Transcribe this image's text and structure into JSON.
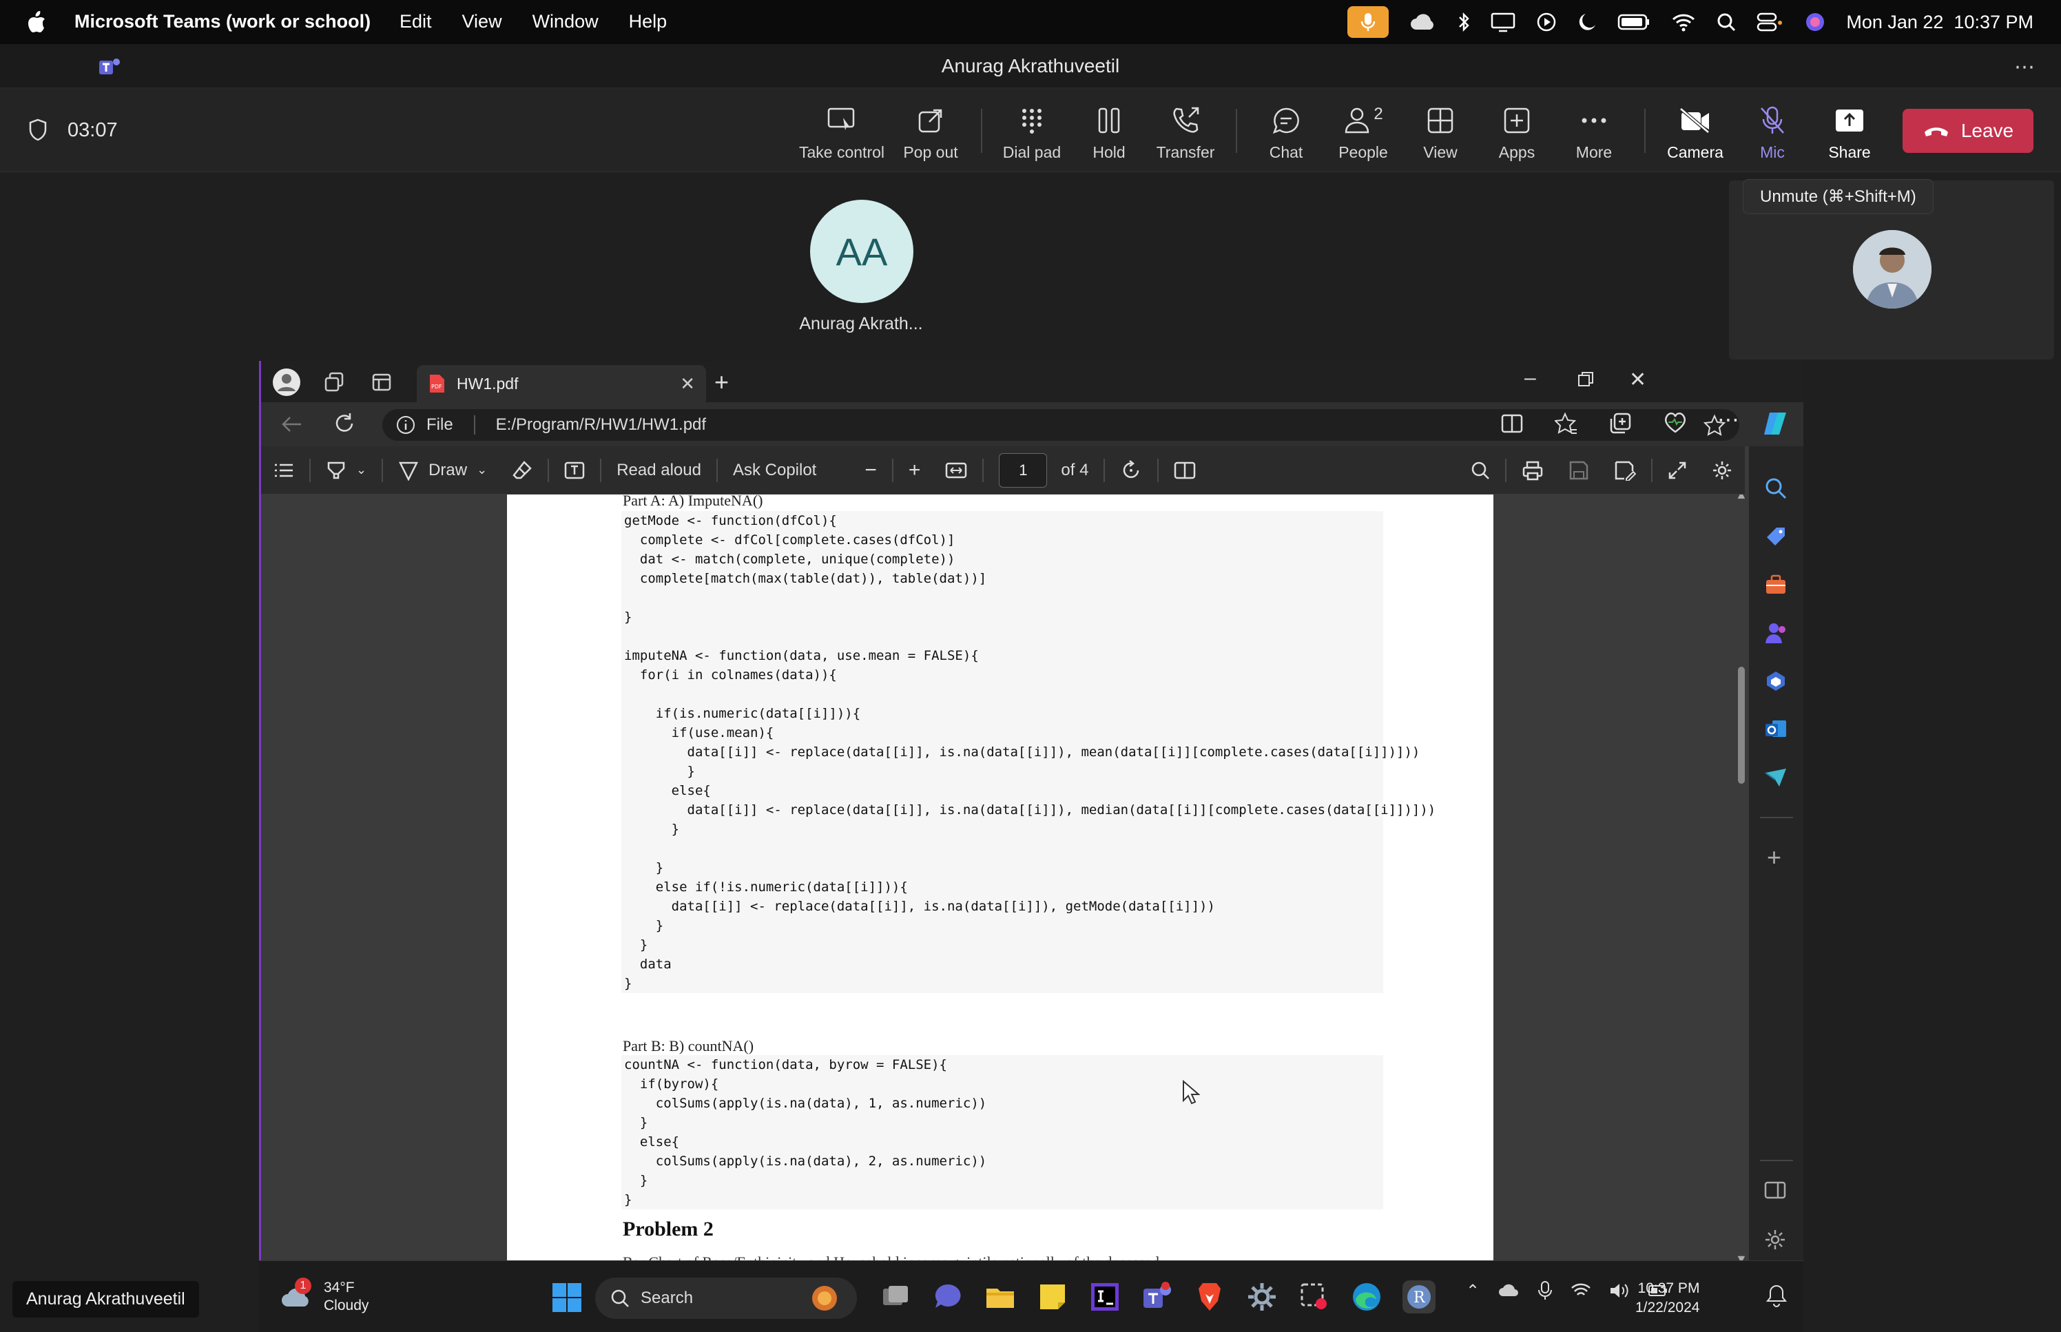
{
  "menubar": {
    "app_name": "Microsoft Teams (work or school)",
    "menus": [
      "Edit",
      "View",
      "Window",
      "Help"
    ],
    "datetime": "Mon Jan 22  10:37 PM"
  },
  "teams": {
    "window_title": "Anurag Akrathuveetil",
    "call_timer": "03:07",
    "toolbar": {
      "take_control": "Take control",
      "pop_out": "Pop out",
      "dial_pad": "Dial pad",
      "hold": "Hold",
      "transfer": "Transfer",
      "chat": "Chat",
      "people": "People",
      "people_count": "2",
      "view": "View",
      "apps": "Apps",
      "more": "More",
      "camera": "Camera",
      "mic": "Mic",
      "share": "Share",
      "leave": "Leave"
    },
    "mic_tooltip": "Unmute (⌘+Shift+M)",
    "participant": {
      "initials": "AA",
      "name": "Anurag Akrath..."
    },
    "self_name_tag": "Anurag Akrathuveetil"
  },
  "edge": {
    "tab_title": "HW1.pdf",
    "address_scheme": "File",
    "address_path": "E:/Program/R/HW1/HW1.pdf",
    "pdf_toolbar": {
      "draw": "Draw",
      "read_aloud": "Read aloud",
      "ask_copilot": "Ask Copilot",
      "page_number": "1",
      "page_total": "of 4"
    }
  },
  "pdf": {
    "part_a_heading": "Part A: A) ImputeNA()",
    "part_a_code": [
      "getMode <- function(dfCol){",
      "  complete <- dfCol[complete.cases(dfCol)]",
      "  dat <- match(complete, unique(complete))",
      "  complete[match(max(table(dat)), table(dat))]",
      "",
      "}",
      "",
      "imputeNA <- function(data, use.mean = FALSE){",
      "  for(i in colnames(data)){",
      "",
      "    if(is.numeric(data[[i]])){",
      "      if(use.mean){",
      "        data[[i]] <- replace(data[[i]], is.na(data[[i]]), mean(data[[i]][complete.cases(data[[i]])]))",
      "        }",
      "      else{",
      "        data[[i]] <- replace(data[[i]], is.na(data[[i]]), median(data[[i]][complete.cases(data[[i]])]))",
      "      }",
      "",
      "    }",
      "    else if(!is.numeric(data[[i]])){",
      "      data[[i]] <- replace(data[[i]], is.na(data[[i]]), getMode(data[[i]]))",
      "    }",
      "  }",
      "  data",
      "}"
    ],
    "part_b_heading": "Part B: B) countNA()",
    "part_b_code": [
      "countNA <- function(data, byrow = FALSE){",
      "  if(byrow){",
      "    colSums(apply(is.na(data), 1, as.numeric))",
      "  }",
      "  else{",
      "    colSums(apply(is.na(data), 2, as.numeric))",
      "  }",
      "}"
    ],
    "problem_heading": "Problem 2",
    "problem_subtitle": "Bar Chart of Race/Enthinicity and Household income quintile nationally of the deceased"
  },
  "taskbar": {
    "weather_badge": "1",
    "temperature": "34°F",
    "condition": "Cloudy",
    "search_label": "Search",
    "time": "10:37 PM",
    "date": "1/22/2024"
  },
  "colors": {
    "leave_red": "#c4314b",
    "mic_active_orange": "#f0a030",
    "mic_muted_purple": "#9a8cf0",
    "share_border_purple": "#7a3ac4"
  }
}
